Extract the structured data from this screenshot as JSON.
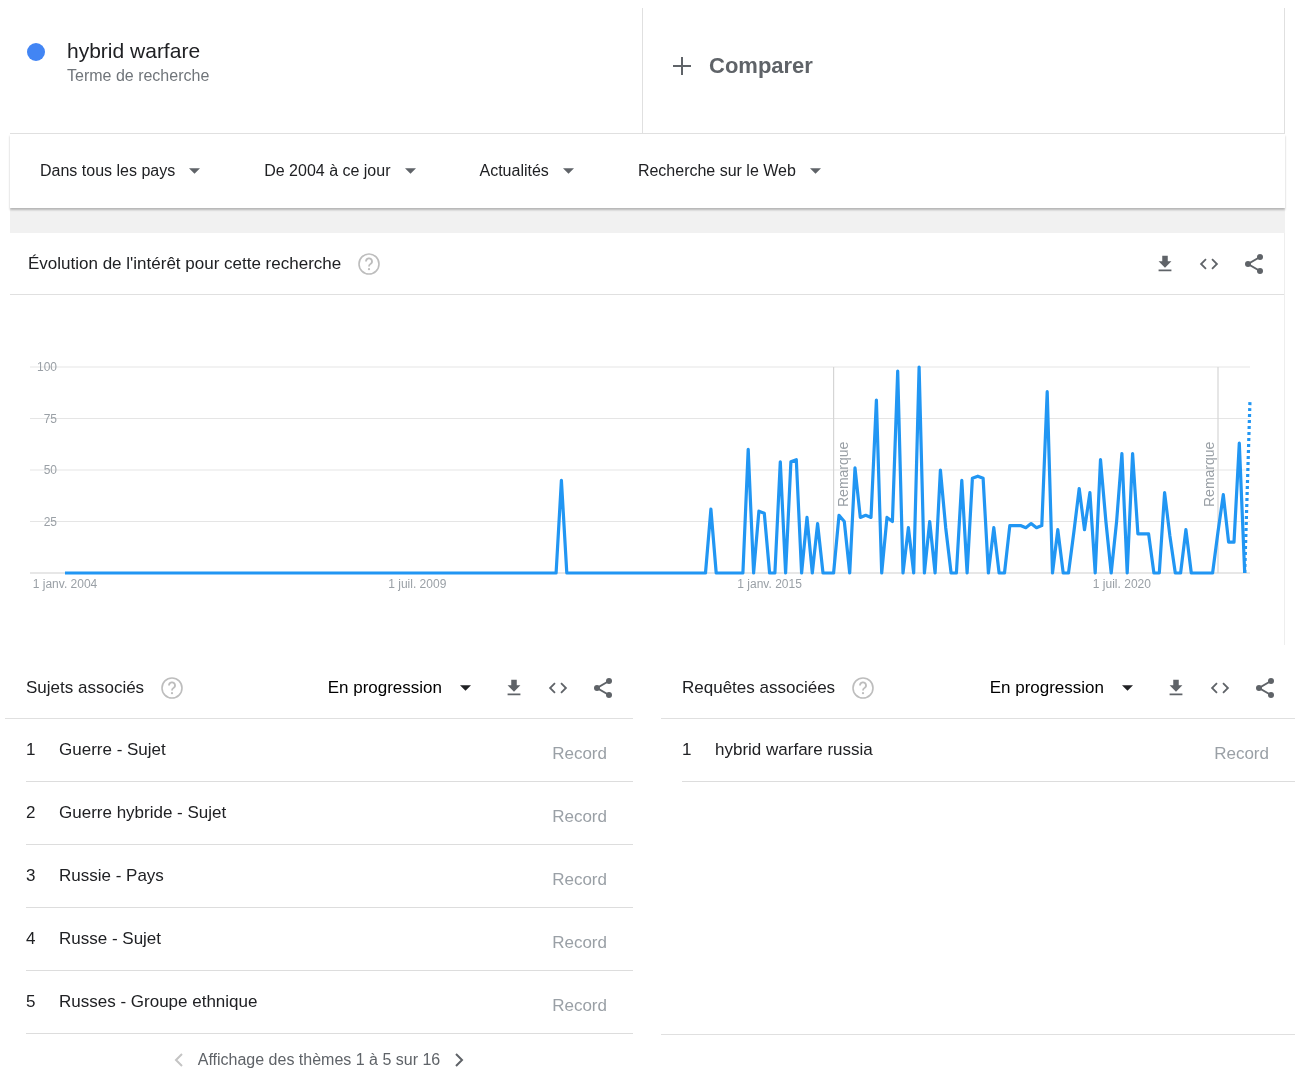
{
  "search_terms": [
    {
      "label": "hybrid warfare",
      "sublabel": "Terme de recherche",
      "color": "#4285f4"
    }
  ],
  "compare": {
    "label": "Comparer"
  },
  "filters": [
    {
      "label": "Dans tous les pays"
    },
    {
      "label": "De 2004 à ce jour"
    },
    {
      "label": "Actualités"
    },
    {
      "label": "Recherche sur le Web"
    }
  ],
  "interest_over_time": {
    "title": "Évolution de l'intérêt pour cette recherche",
    "chart_data": {
      "type": "line",
      "grid": true,
      "ylim": [
        0,
        100
      ],
      "categories": [
        "1 janv. 2004",
        null,
        null,
        null,
        null,
        null,
        null,
        null,
        null,
        null,
        null,
        null,
        null,
        null,
        null,
        null,
        null,
        null,
        null,
        null,
        null,
        null,
        null,
        null,
        null,
        null,
        null,
        null,
        null,
        null,
        null,
        null,
        null,
        null,
        null,
        null,
        null,
        null,
        null,
        null,
        null,
        null,
        null,
        null,
        null,
        null,
        null,
        null,
        null,
        null,
        null,
        null,
        null,
        null,
        null,
        null,
        null,
        null,
        null,
        null,
        null,
        null,
        null,
        null,
        null,
        null,
        "1 juil. 2009",
        null,
        null,
        null,
        null,
        null,
        null,
        null,
        null,
        null,
        null,
        null,
        null,
        null,
        null,
        null,
        null,
        null,
        null,
        null,
        null,
        null,
        null,
        null,
        null,
        null,
        null,
        null,
        null,
        null,
        null,
        null,
        null,
        null,
        null,
        null,
        null,
        null,
        null,
        null,
        null,
        null,
        null,
        null,
        null,
        null,
        null,
        null,
        null,
        null,
        null,
        null,
        null,
        null,
        null,
        null,
        null,
        null,
        null,
        null,
        null,
        null,
        null,
        null,
        null,
        null,
        "1 janv. 2015",
        null,
        null,
        null,
        null,
        null,
        null,
        null,
        null,
        null,
        null,
        null,
        null,
        null,
        null,
        null,
        null,
        null,
        null,
        null,
        null,
        null,
        null,
        null,
        null,
        null,
        null,
        null,
        null,
        null,
        null,
        null,
        null,
        null,
        null,
        null,
        null,
        null,
        null,
        null,
        null,
        null,
        null,
        null,
        null,
        null,
        null,
        null,
        null,
        null,
        null,
        null,
        null,
        null,
        null,
        null,
        null,
        null,
        null,
        null,
        null,
        null,
        null,
        null,
        null,
        null,
        "1 juil. 2020",
        null,
        null,
        null,
        null,
        null,
        null,
        null,
        null,
        null,
        null,
        null,
        null,
        null,
        null,
        null,
        null,
        null,
        null,
        null,
        null,
        null,
        null,
        null,
        null
      ],
      "yticks": [
        25,
        50,
        75,
        100
      ],
      "series": [
        {
          "color": "#2196f3",
          "line_style": "solid",
          "values": [
            0,
            0,
            0,
            0,
            0,
            0,
            0,
            0,
            0,
            0,
            0,
            0,
            0,
            0,
            0,
            0,
            0,
            0,
            0,
            0,
            0,
            0,
            0,
            0,
            0,
            0,
            0,
            0,
            0,
            0,
            0,
            0,
            0,
            0,
            0,
            0,
            0,
            0,
            0,
            0,
            0,
            0,
            0,
            0,
            0,
            0,
            0,
            0,
            0,
            0,
            0,
            0,
            0,
            0,
            0,
            0,
            0,
            0,
            0,
            0,
            0,
            0,
            0,
            0,
            0,
            0,
            0,
            0,
            0,
            0,
            0,
            0,
            0,
            0,
            0,
            0,
            0,
            0,
            0,
            0,
            0,
            0,
            0,
            0,
            0,
            0,
            0,
            0,
            0,
            0,
            0,
            0,
            0,
            45,
            0,
            0,
            0,
            0,
            0,
            0,
            0,
            0,
            0,
            0,
            0,
            0,
            0,
            0,
            0,
            0,
            0,
            0,
            0,
            0,
            0,
            0,
            0,
            0,
            0,
            0,
            0,
            31,
            0,
            0,
            0,
            0,
            0,
            0,
            60,
            0,
            30,
            29,
            0,
            0,
            54,
            0,
            54,
            55,
            0,
            27,
            0,
            24,
            0,
            0,
            0,
            28,
            25,
            0,
            51,
            27,
            28,
            27,
            84,
            0,
            27,
            25,
            98,
            0,
            22,
            0,
            100,
            0,
            25,
            0,
            50,
            22,
            0,
            0,
            45,
            0,
            46,
            47,
            46,
            0,
            22,
            0,
            0,
            23,
            23,
            23,
            22,
            24,
            22,
            23,
            88,
            0,
            21,
            0,
            0,
            20,
            41,
            21,
            39,
            0,
            55,
            25,
            0,
            25,
            58,
            0,
            58,
            19,
            19,
            19,
            0,
            0,
            39,
            18,
            0,
            0,
            21,
            0,
            0,
            0,
            0,
            0,
            20,
            38,
            15,
            15,
            63,
            0,
            null
          ]
        },
        {
          "color": "#2196f3",
          "line_style": "dotted",
          "values": [
            null,
            null,
            null,
            null,
            null,
            null,
            null,
            null,
            null,
            null,
            null,
            null,
            null,
            null,
            null,
            null,
            null,
            null,
            null,
            null,
            null,
            null,
            null,
            null,
            null,
            null,
            null,
            null,
            null,
            null,
            null,
            null,
            null,
            null,
            null,
            null,
            null,
            null,
            null,
            null,
            null,
            null,
            null,
            null,
            null,
            null,
            null,
            null,
            null,
            null,
            null,
            null,
            null,
            null,
            null,
            null,
            null,
            null,
            null,
            null,
            null,
            null,
            null,
            null,
            null,
            null,
            null,
            null,
            null,
            null,
            null,
            null,
            null,
            null,
            null,
            null,
            null,
            null,
            null,
            null,
            null,
            null,
            null,
            null,
            null,
            null,
            null,
            null,
            null,
            null,
            null,
            null,
            null,
            null,
            null,
            null,
            null,
            null,
            null,
            null,
            null,
            null,
            null,
            null,
            null,
            null,
            null,
            null,
            null,
            null,
            null,
            null,
            null,
            null,
            null,
            null,
            null,
            null,
            null,
            null,
            null,
            null,
            null,
            null,
            null,
            null,
            null,
            null,
            null,
            null,
            null,
            null,
            null,
            null,
            null,
            null,
            null,
            null,
            null,
            null,
            null,
            null,
            null,
            null,
            null,
            null,
            null,
            null,
            null,
            null,
            null,
            null,
            null,
            null,
            null,
            null,
            null,
            null,
            null,
            null,
            null,
            null,
            null,
            null,
            null,
            null,
            null,
            null,
            null,
            null,
            null,
            null,
            null,
            null,
            null,
            null,
            null,
            null,
            null,
            null,
            null,
            null,
            null,
            null,
            null,
            null,
            null,
            null,
            null,
            null,
            null,
            null,
            null,
            null,
            null,
            null,
            null,
            null,
            null,
            null,
            null,
            null,
            null,
            null,
            null,
            null,
            null,
            null,
            null,
            null,
            null,
            null,
            null,
            null,
            null,
            null,
            null,
            null,
            null,
            null,
            null,
            0,
            84
          ]
        }
      ],
      "annotations": [
        "Remarque",
        "Remarque"
      ]
    }
  },
  "related_topics": {
    "title": "Sujets associés",
    "sort": "En progression",
    "items": [
      {
        "rank": "1",
        "label": "Guerre - Sujet",
        "value": "Record"
      },
      {
        "rank": "2",
        "label": "Guerre hybride - Sujet",
        "value": "Record"
      },
      {
        "rank": "3",
        "label": "Russie - Pays",
        "value": "Record"
      },
      {
        "rank": "4",
        "label": "Russe - Sujet",
        "value": "Record"
      },
      {
        "rank": "5",
        "label": "Russes - Groupe ethnique",
        "value": "Record"
      }
    ],
    "pagination": {
      "text": "Affichage des thèmes 1 à 5 sur 16",
      "previous_disabled": true,
      "next_disabled": false
    }
  },
  "related_queries": {
    "title": "Requêtes associées",
    "sort": "En progression",
    "items": [
      {
        "rank": "1",
        "label": "hybrid warfare russia",
        "value": "Record"
      }
    ]
  }
}
